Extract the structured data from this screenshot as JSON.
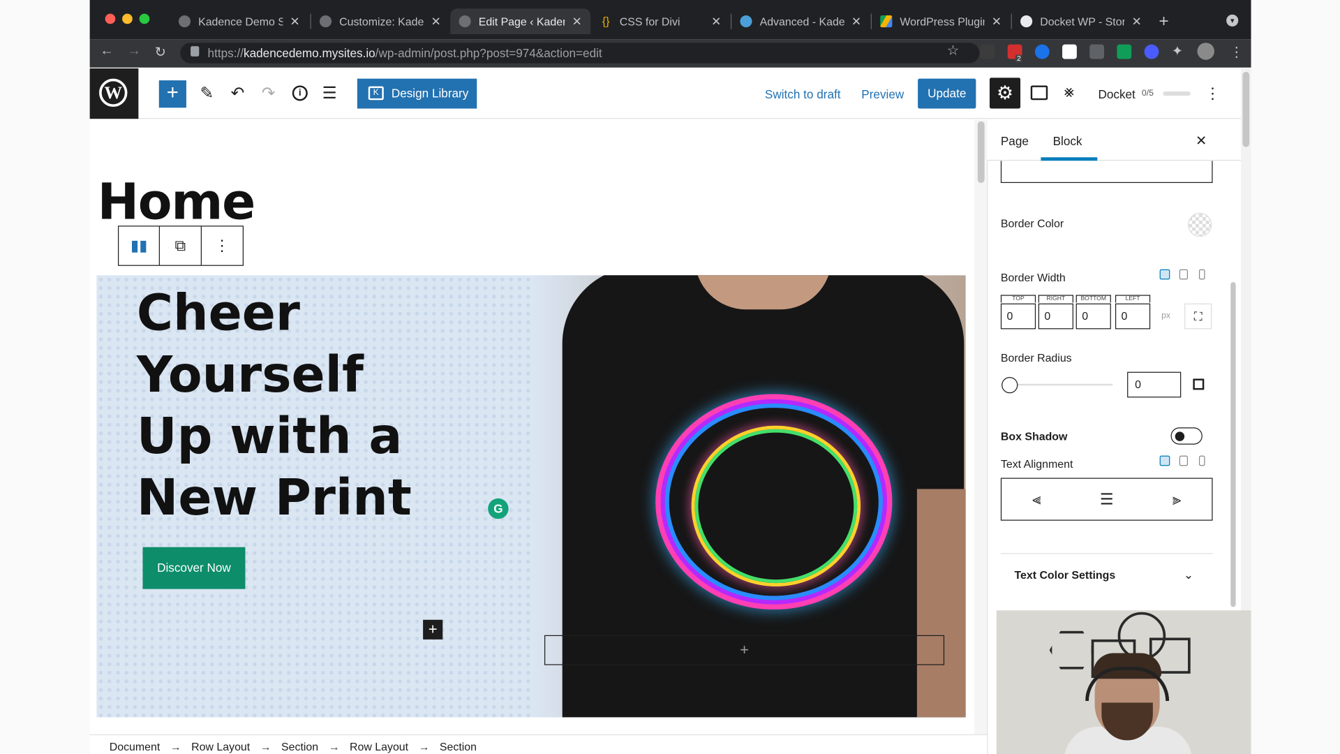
{
  "browser": {
    "tabs": [
      {
        "title": "Kadence Demo Si"
      },
      {
        "title": "Customize: Kade"
      },
      {
        "title": "Edit Page ‹ Kaden",
        "active": true
      },
      {
        "title": "CSS for Divi"
      },
      {
        "title": "Advanced - Kade"
      },
      {
        "title": "WordPress Plugin"
      },
      {
        "title": "Docket WP - Stor"
      }
    ],
    "url_prefix": "https://",
    "url_host": "kadencedemo.mysites.io",
    "url_path": "/wp-admin/post.php?post=974&action=edit",
    "extension_badge": "2"
  },
  "toolbar": {
    "design_library_label": "Design Library",
    "switch_to_draft_label": "Switch to draft",
    "preview_label": "Preview",
    "update_label": "Update",
    "docket_label": "Docket",
    "docket_count": "0/5"
  },
  "page": {
    "title": "Home",
    "hero_heading": "Cheer Yourself Up with a New Print",
    "button_label": "Discover Now"
  },
  "breadcrumb": [
    "Document",
    "Row Layout",
    "Section",
    "Row Layout",
    "Section"
  ],
  "sidebar": {
    "tab_page": "Page",
    "tab_block": "Block",
    "border_color_label": "Border Color",
    "border_width_label": "Border Width",
    "border_sides": [
      {
        "label": "TOP",
        "value": "0"
      },
      {
        "label": "RIGHT",
        "value": "0"
      },
      {
        "label": "BOTTOM",
        "value": "0"
      },
      {
        "label": "LEFT",
        "value": "0"
      }
    ],
    "unit": "px",
    "border_radius_label": "Border Radius",
    "border_radius_value": "0",
    "box_shadow_label": "Box Shadow",
    "box_shadow_enabled": false,
    "text_alignment_label": "Text Alignment",
    "text_color_settings_label": "Text Color Settings"
  },
  "colors": {
    "wp_blue": "#2271b1",
    "button_green": "#0d8d6a",
    "dark": "#1e1e1e"
  }
}
